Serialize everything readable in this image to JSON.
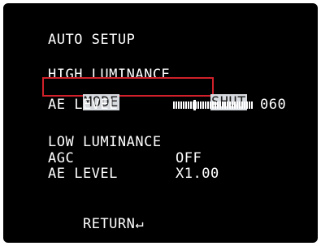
{
  "menu": {
    "title": "AUTO SETUP",
    "high_luminance": {
      "heading": "HIGH LUMINANCE",
      "mode_label": "MODE",
      "mode_value": "SHUT",
      "ae_level_label": "AE LEVEL",
      "ae_level_value": "060",
      "ae_level_slider_fraction": 0.25
    },
    "low_luminance": {
      "heading": "LOW LUMINANCE",
      "agc_label": "AGC",
      "agc_value": "OFF",
      "ae_level_label": "AE LEVEL",
      "ae_level_value": "X1.00"
    },
    "return_label": "RETURN",
    "return_icon": "↵"
  },
  "colors": {
    "background": "#000000",
    "text": "#ffffff",
    "selection_highlight": "#d7dadf",
    "focus_border": "#d0202a"
  }
}
